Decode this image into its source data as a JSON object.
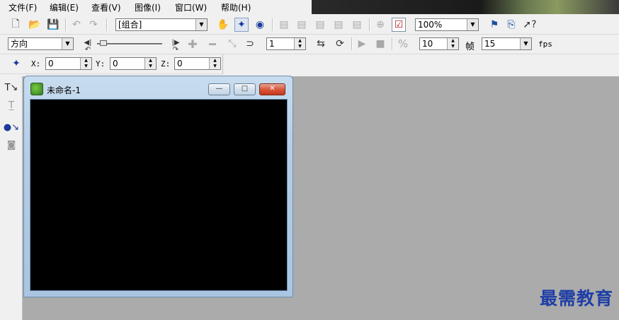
{
  "menu": [
    {
      "key": "file",
      "label": "文件(F)"
    },
    {
      "key": "edit",
      "label": "编辑(E)"
    },
    {
      "key": "view",
      "label": "查看(V)"
    },
    {
      "key": "image",
      "label": "图像(I)"
    },
    {
      "key": "window",
      "label": "窗口(W)"
    },
    {
      "key": "help",
      "label": "帮助(H)"
    }
  ],
  "toolbar1": {
    "group_combo": "[组合]",
    "zoom_combo": "100%"
  },
  "toolbar2": {
    "direction_combo": "方向",
    "step_value": "1",
    "percent_value": "10",
    "frame_label": "帧",
    "fps_value": "15",
    "fps_label": "fps",
    "slider_position": 0.05
  },
  "toolbar3": {
    "x_label": "X:",
    "x_value": "0",
    "y_label": "Y:",
    "y_value": "0",
    "z_label": "Z:",
    "z_value": "0"
  },
  "child_window": {
    "title": "未命名-1",
    "minimize_glyph": "—",
    "maximize_glyph": "□",
    "close_glyph": "✕"
  },
  "watermark": "最需教育",
  "colors": {
    "workspace": "#ababab",
    "canvas": "#000000",
    "watermark": "#1f3fa6"
  }
}
